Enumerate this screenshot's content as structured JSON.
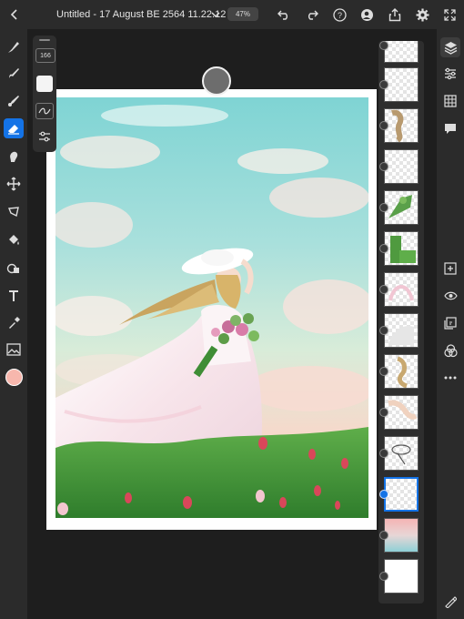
{
  "topbar": {
    "doc_title": "Untitled - 17 August BE 2564 11.22.12 *",
    "zoom": "47%"
  },
  "tool_options": {
    "brush_size": "166"
  },
  "colors": {
    "accent": "#1473e6",
    "current_color": "#f7b7ad",
    "panel": "#2b2b2b"
  },
  "layers": {
    "count": 14,
    "selected_index": 11
  }
}
